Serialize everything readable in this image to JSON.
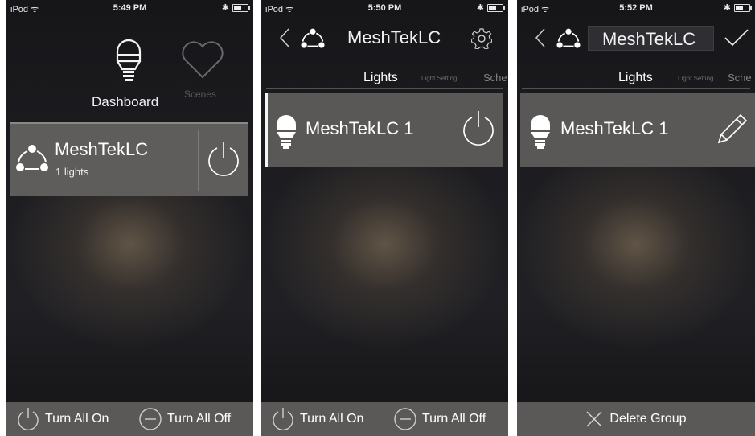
{
  "screens": [
    {
      "status": {
        "carrier": "iPod",
        "time": "5:49 PM"
      },
      "dashboard_label": "Dashboard",
      "scenes_label": "Scenes",
      "group": {
        "name": "MeshTekLC",
        "subtitle": "1 lights"
      },
      "bottom": {
        "turn_on": "Turn All On",
        "turn_off": "Turn All Off"
      }
    },
    {
      "status": {
        "carrier": "iPod",
        "time": "5:50 PM"
      },
      "title": "MeshTekLC",
      "tabs": {
        "lights": "Lights",
        "light_setting": "Light Setting",
        "schedule": "Sche"
      },
      "light": {
        "name": "MeshTekLC  1"
      },
      "bottom": {
        "turn_on": "Turn All On",
        "turn_off": "Turn All Off"
      }
    },
    {
      "status": {
        "carrier": "iPod",
        "time": "5:52 PM"
      },
      "title_field_value": "MeshTekLC",
      "tabs": {
        "lights": "Lights",
        "light_setting": "Light Setting",
        "schedule": "Sche"
      },
      "light": {
        "name": "MeshTekLC  1"
      },
      "bottom": {
        "delete": "Delete Group"
      }
    }
  ],
  "icons": [
    "wifi-icon",
    "bluetooth-icon",
    "battery-icon",
    "lightbulb-icon",
    "heart-icon",
    "group-icon",
    "power-icon",
    "back-chevron-icon",
    "gear-icon",
    "check-icon",
    "pencil-icon",
    "minus-circle-icon",
    "close-x-icon"
  ],
  "colors": {
    "card": "#5f5d5c",
    "bottom_bar": "#5a5958",
    "text": "#ffffff"
  }
}
